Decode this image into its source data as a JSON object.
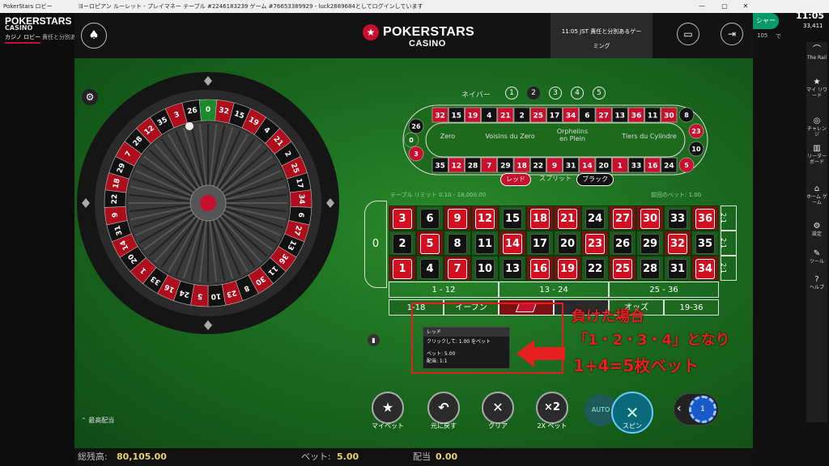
{
  "background_app": {
    "title": "PokerStars ロビー",
    "logo_line1": "POKERSTARS",
    "logo_line2": "CASINO",
    "tabs": [
      "カジノ ロビー",
      "責任と分別あるゲーミング"
    ],
    "time": "11:05",
    "balance_short": "33,411",
    "side_button": "シャー",
    "side_small": "105",
    "side_small2": "で"
  },
  "window": {
    "title": "ヨーロピアン ルーレット - プレイマネー テーブル #2246183239 ゲーム #76653389929 - luck2889684としてログインしています",
    "controls": [
      "—",
      "▢",
      "✕"
    ]
  },
  "header": {
    "logo_line1": "POKERSTARS",
    "logo_line2": "CASINO",
    "info_line1": "11:05 JST 責任と分別あるゲー",
    "info_line2": "ミング"
  },
  "neighbors": {
    "label": "ネイバー",
    "options": [
      "1",
      "2",
      "3",
      "4",
      "5"
    ],
    "selected": "2"
  },
  "racetrack": {
    "top_row": [
      "32",
      "15",
      "19",
      "4",
      "21",
      "2",
      "25",
      "17",
      "34",
      "6",
      "27",
      "13",
      "36",
      "11",
      "30"
    ],
    "bottom_row": [
      "35",
      "12",
      "28",
      "7",
      "29",
      "18",
      "22",
      "9",
      "31",
      "14",
      "20",
      "1",
      "33",
      "16",
      "24"
    ],
    "left_numbers": [
      "26",
      "0",
      "3"
    ],
    "right_numbers": [
      "8",
      "23",
      "10",
      "5"
    ],
    "sections": [
      "Zero",
      "Voisins du Zero",
      "Orphelins en Plein",
      "Tiers du Cylindre"
    ]
  },
  "bet_toggle": {
    "red": "レッド",
    "split": "スプリット",
    "black": "ブラック"
  },
  "table_limits": {
    "left": "テーブル リミット 0.10 - 18,000.00",
    "right": "前回のベット: 1.00"
  },
  "board": {
    "zero": "0",
    "rows": [
      [
        {
          "n": "3",
          "c": "red"
        },
        {
          "n": "6",
          "c": "black"
        },
        {
          "n": "9",
          "c": "red"
        },
        {
          "n": "12",
          "c": "red"
        },
        {
          "n": "15",
          "c": "black"
        },
        {
          "n": "18",
          "c": "red"
        },
        {
          "n": "21",
          "c": "red"
        },
        {
          "n": "24",
          "c": "black"
        },
        {
          "n": "27",
          "c": "red"
        },
        {
          "n": "30",
          "c": "red"
        },
        {
          "n": "33",
          "c": "black"
        },
        {
          "n": "36",
          "c": "red"
        }
      ],
      [
        {
          "n": "2",
          "c": "black"
        },
        {
          "n": "5",
          "c": "red"
        },
        {
          "n": "8",
          "c": "black"
        },
        {
          "n": "11",
          "c": "black"
        },
        {
          "n": "14",
          "c": "red"
        },
        {
          "n": "17",
          "c": "black"
        },
        {
          "n": "20",
          "c": "black"
        },
        {
          "n": "23",
          "c": "red"
        },
        {
          "n": "26",
          "c": "black"
        },
        {
          "n": "29",
          "c": "black"
        },
        {
          "n": "32",
          "c": "red"
        },
        {
          "n": "35",
          "c": "black"
        }
      ],
      [
        {
          "n": "1",
          "c": "red"
        },
        {
          "n": "4",
          "c": "black"
        },
        {
          "n": "7",
          "c": "red"
        },
        {
          "n": "10",
          "c": "black"
        },
        {
          "n": "13",
          "c": "black"
        },
        {
          "n": "16",
          "c": "red"
        },
        {
          "n": "19",
          "c": "red"
        },
        {
          "n": "22",
          "c": "black"
        },
        {
          "n": "25",
          "c": "red"
        },
        {
          "n": "28",
          "c": "black"
        },
        {
          "n": "31",
          "c": "black"
        },
        {
          "n": "34",
          "c": "red"
        }
      ]
    ],
    "column_bets": [
      "2:1",
      "2:1",
      "2:1"
    ],
    "dozens": [
      "1 - 12",
      "13 - 24",
      "25 - 36"
    ],
    "outside": [
      "1-18",
      "イーブン",
      "",
      "",
      "オッズ",
      "19-36"
    ]
  },
  "tooltip": {
    "title": "レッド",
    "line1": "クリックして: 1.00 をベット",
    "line2": "ベット: 5.00",
    "line3": "配当: 1:1"
  },
  "annotation": {
    "line1": "負けた場合",
    "line2": "「1・2・3・4」となり",
    "line3": "1+4=5枚ベット"
  },
  "wheel": {
    "numbers": [
      "0",
      "32",
      "15",
      "19",
      "4",
      "21",
      "2",
      "25",
      "17",
      "34",
      "6",
      "27",
      "13",
      "36",
      "11",
      "30",
      "8",
      "23",
      "10",
      "5",
      "24",
      "16",
      "33",
      "1",
      "20",
      "14",
      "31",
      "9",
      "22",
      "18",
      "29",
      "7",
      "28",
      "12",
      "35",
      "3",
      "26"
    ]
  },
  "controls": {
    "my_bet": "マイベット",
    "undo": "元に戻す",
    "clear": "クリア",
    "double": "2X ベット",
    "double_icon": "×2",
    "spin": "スピン",
    "auto": "AUTO",
    "chip_value": "1"
  },
  "recent_label": "最高配当",
  "footer": {
    "balance_label": "総残高:",
    "balance": "80,105.00",
    "bet_label": "ベット:",
    "bet": "5.00",
    "payout_label": "配当",
    "payout": "0.00"
  },
  "rail": {
    "items": [
      "The Rail",
      "マイ リワード",
      "チャレンジ",
      "リーダー ボード",
      "ホーム ゲーム",
      "設定",
      "ツール",
      "ヘルプ"
    ]
  },
  "colors": {
    "red": "#d01020",
    "black": "#111111",
    "felt": "#1a6a1f",
    "annotation": "#e62020"
  }
}
